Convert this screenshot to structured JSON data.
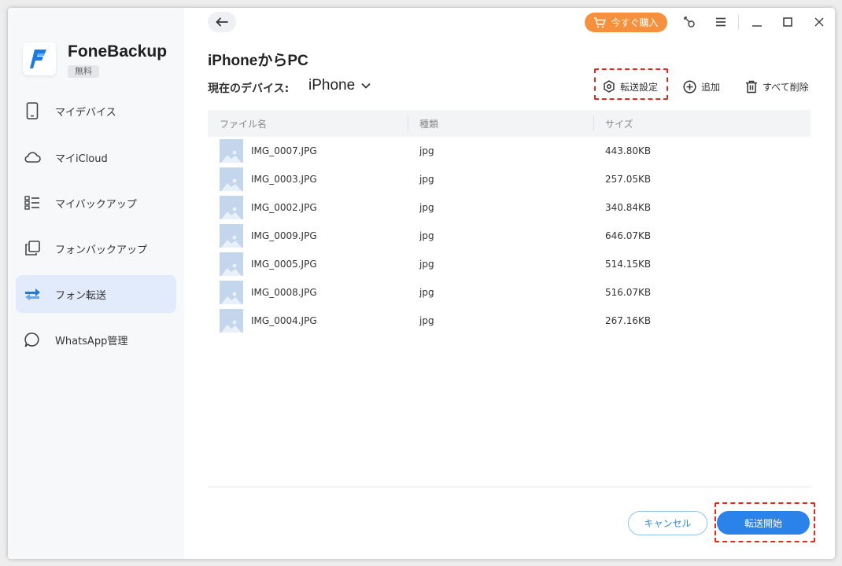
{
  "app": {
    "name": "FoneBackup",
    "badge": "無料"
  },
  "sidebar": {
    "items": [
      {
        "label": "マイデバイス",
        "icon": "phone-icon"
      },
      {
        "label": "マイiCloud",
        "icon": "cloud-icon"
      },
      {
        "label": "マイバックアップ",
        "icon": "list-icon"
      },
      {
        "label": "フォンバックアップ",
        "icon": "copy-icon"
      },
      {
        "label": "フォン転送",
        "icon": "transfer-icon",
        "active": true
      },
      {
        "label": "WhatsApp管理",
        "icon": "chat-icon"
      }
    ]
  },
  "titlebar": {
    "buy_label": "今すぐ購入"
  },
  "main": {
    "title": "iPhoneからPC",
    "device_label": "現在のデバイス:",
    "device_value": "iPhone",
    "actions": {
      "settings": "転送設定",
      "add": "追加",
      "delete_all": "すべて削除"
    },
    "table": {
      "headers": [
        "ファイル名",
        "種類",
        "サイズ"
      ],
      "rows": [
        {
          "name": "IMG_0007.JPG",
          "type": "jpg",
          "size": "443.80KB"
        },
        {
          "name": "IMG_0003.JPG",
          "type": "jpg",
          "size": "257.05KB"
        },
        {
          "name": "IMG_0002.JPG",
          "type": "jpg",
          "size": "340.84KB"
        },
        {
          "name": "IMG_0009.JPG",
          "type": "jpg",
          "size": "646.07KB"
        },
        {
          "name": "IMG_0005.JPG",
          "type": "jpg",
          "size": "514.15KB"
        },
        {
          "name": "IMG_0008.JPG",
          "type": "jpg",
          "size": "516.07KB"
        },
        {
          "name": "IMG_0004.JPG",
          "type": "jpg",
          "size": "267.16KB"
        }
      ]
    },
    "buttons": {
      "cancel": "キャンセル",
      "start": "転送開始"
    }
  },
  "colors": {
    "accent": "#2b83ea",
    "buy": "#f5913e",
    "highlight": "#e02a20",
    "active_nav": "#e1ebfb"
  }
}
